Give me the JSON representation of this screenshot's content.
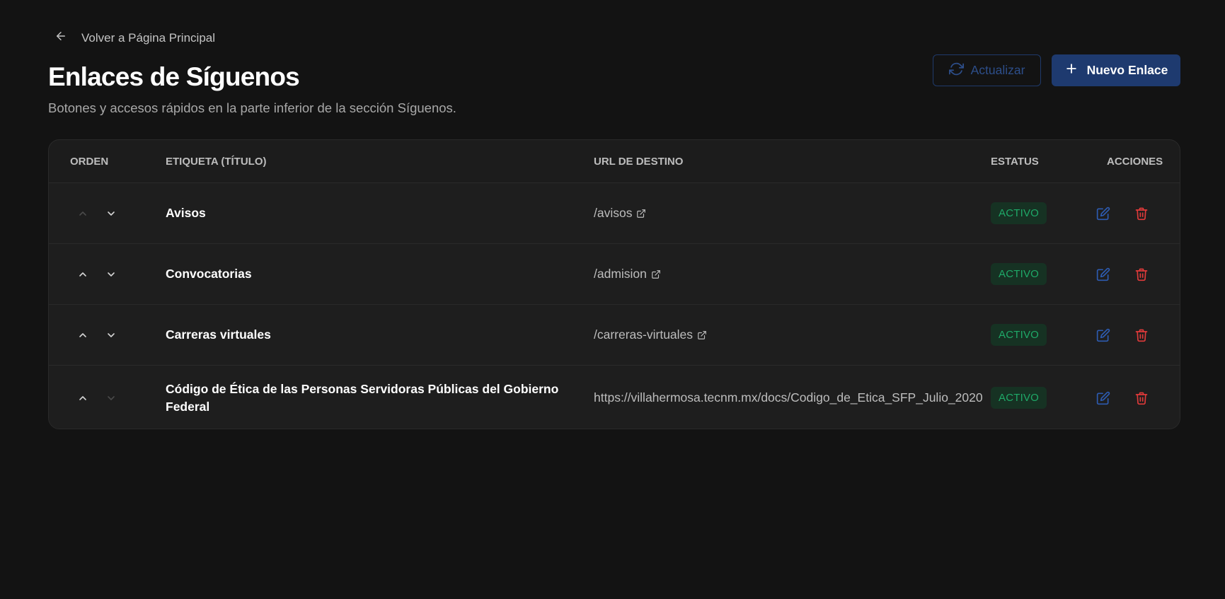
{
  "nav": {
    "back_label": "Volver a Página Principal"
  },
  "header": {
    "title": "Enlaces de Síguenos",
    "subtitle": "Botones y accesos rápidos en la parte inferior de la sección Síguenos.",
    "refresh_label": "Actualizar",
    "new_label": "Nuevo Enlace"
  },
  "table": {
    "columns": {
      "order": "ORDEN",
      "label": "ETIQUETA (TÍTULO)",
      "url": "URL DE DESTINO",
      "status": "ESTATUS",
      "actions": "ACCIONES"
    },
    "rows": [
      {
        "label": "Avisos",
        "url": "/avisos",
        "status": "ACTIVO",
        "up_enabled": false,
        "down_enabled": true,
        "external_icon": true
      },
      {
        "label": "Convocatorias",
        "url": "/admision",
        "status": "ACTIVO",
        "up_enabled": true,
        "down_enabled": true,
        "external_icon": true
      },
      {
        "label": "Carreras virtuales",
        "url": "/carreras-virtuales",
        "status": "ACTIVO",
        "up_enabled": true,
        "down_enabled": true,
        "external_icon": true
      },
      {
        "label": "Código de Ética de las Personas Servidoras Públicas del Gobierno Federal",
        "url": "https://villahermosa.tecnm.mx/docs/Codigo_de_Etica_SFP_Julio_2020",
        "status": "ACTIVO",
        "up_enabled": true,
        "down_enabled": false,
        "external_icon": false
      }
    ]
  },
  "colors": {
    "background": "#131313",
    "primary": "#1e3a6f",
    "status_active": "#1fa968",
    "delete": "#e03a3a"
  },
  "icons": {
    "back": "arrow-left-icon",
    "refresh": "refresh-icon",
    "new": "plus-icon",
    "up": "chevron-up-icon",
    "down": "chevron-down-icon",
    "external": "external-link-icon",
    "edit": "edit-icon",
    "delete": "trash-icon"
  }
}
